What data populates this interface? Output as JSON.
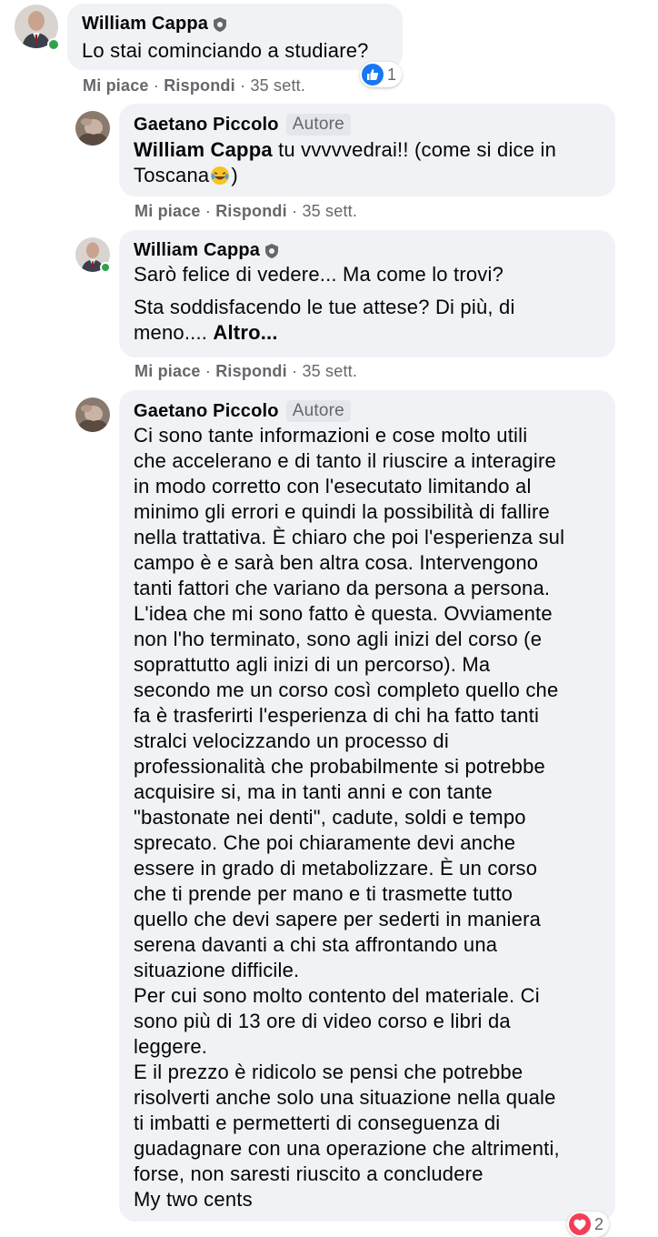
{
  "comments": [
    {
      "author": "William Cappa",
      "text": "Lo stai cominciando a studiare?",
      "like_label": "Mi piace",
      "reply_label": "Rispondi",
      "time": "35 sett.",
      "reaction_count": "1"
    },
    {
      "author": "Gaetano Piccolo",
      "badge": "Autore",
      "mention": "William Cappa",
      "text_line1": " tu vvvvvedrai!! (come si dice in",
      "text_line2": "Toscana",
      "text_line2_end": ")",
      "like_label": "Mi piace",
      "reply_label": "Rispondi",
      "time": "35 sett."
    },
    {
      "author": "William Cappa",
      "para1": "Sarò felice di vedere... Ma come lo trovi?",
      "para2_line1": "Sta soddisfacendo le tue attese? Di più, di",
      "para2_line2": "meno.... ",
      "more": "Altro...",
      "like_label": "Mi piace",
      "reply_label": "Rispondi",
      "time": "35 sett."
    },
    {
      "author": "Gaetano Piccolo",
      "badge": "Autore",
      "lines": [
        "Ci sono tante informazioni e cose molto utili",
        "che accelerano e di tanto il riuscire a interagire",
        "in modo corretto con l'esecutato limitando al",
        "minimo gli errori e quindi la possibilità di fallire",
        "nella trattativa. È chiaro che poi l'esperienza sul",
        "campo è e sarà ben altra cosa. Intervengono",
        "tanti fattori che variano da persona a persona.",
        "L'idea che mi sono fatto è questa. Ovviamente",
        "non l'ho terminato, sono agli inizi del corso (e",
        "soprattutto agli inizi di un percorso). Ma",
        "secondo me un corso così completo quello che",
        "fa è trasferirti l'esperienza di chi ha fatto tanti",
        "stralci velocizzando un processo di",
        "professionalità che probabilmente si potrebbe",
        "acquisire si, ma in tanti anni e con tante",
        "\"bastonate nei denti\", cadute, soldi e tempo",
        "sprecato. Che poi chiaramente devi anche",
        "essere in grado di metabolizzare. È un corso",
        "che ti prende per mano e ti trasmette tutto",
        "quello che devi sapere per sederti in maniera",
        "serena davanti a chi sta affrontando una",
        "situazione difficile.",
        "Per cui sono molto contento del materiale. Ci",
        "sono più di 13 ore di video corso e libri da",
        "leggere.",
        "E il prezzo è ridicolo se pensi che potrebbe",
        "risolverti anche solo una situazione nella quale",
        "ti imbatti e permetterti di conseguenza di",
        "guadagnare con una operazione che altrimenti,",
        "forse, non saresti riuscito a concludere",
        "My two cents"
      ],
      "reaction_count": "2"
    }
  ],
  "colors": {
    "bubble": "#f0f2f5",
    "meta": "#65676b",
    "like_blue": "#1877f2",
    "love_red": "#f33e58",
    "online": "#31a24c"
  },
  "icons": [
    "verified-shield-icon",
    "like-reaction-icon",
    "love-reaction-icon"
  ]
}
